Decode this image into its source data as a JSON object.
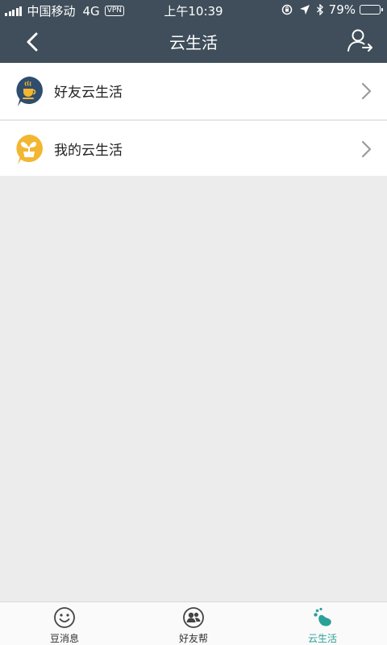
{
  "status_bar": {
    "carrier": "中国移动",
    "network": "4G",
    "vpn": "VPN",
    "time": "上午10:39",
    "battery_text": "79%",
    "battery_level": 0.79
  },
  "nav": {
    "title": "云生活",
    "back_icon": "chevron-left-icon",
    "right_icon": "user-exit-icon"
  },
  "list": {
    "items": [
      {
        "label": "好友云生活",
        "icon": "coffee-cup-icon",
        "icon_color": "#2f4d6e"
      },
      {
        "label": "我的云生活",
        "icon": "sprout-icon",
        "icon_color": "#f2b631"
      }
    ]
  },
  "tabbar": {
    "tabs": [
      {
        "label": "豆消息",
        "icon": "smile-icon",
        "active": false
      },
      {
        "label": "好友帮",
        "icon": "friends-icon",
        "active": false
      },
      {
        "label": "云生活",
        "icon": "footprint-icon",
        "active": true
      }
    ]
  },
  "colors": {
    "header_bg": "#3f4e5a",
    "page_bg": "#ececec",
    "accent": "#2aa197"
  }
}
